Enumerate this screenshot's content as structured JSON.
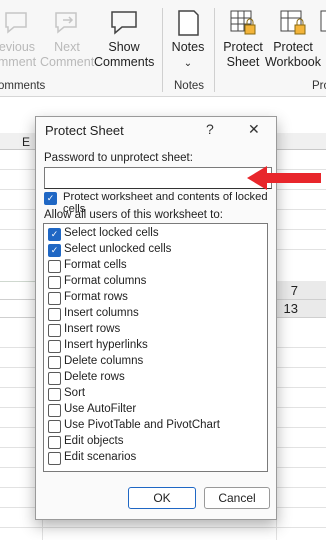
{
  "ribbon": {
    "previous_comment": "Previous Comment",
    "previous_comment_parts": [
      "evious",
      "mment"
    ],
    "next_comment": [
      "Next",
      "Comment"
    ],
    "show_comments": [
      "Show",
      "Comments"
    ],
    "notes": "Notes",
    "protect_sheet": [
      "Protect",
      "Sheet"
    ],
    "protect_workbook": [
      "Protect",
      "Workbook"
    ],
    "protect_more": "Pro",
    "groups": {
      "comments": "Comments",
      "comments_visible": "omments",
      "notes": "Notes",
      "protect": "Pro"
    }
  },
  "sheet": {
    "col_e": "E",
    "values": [
      "7",
      "13"
    ]
  },
  "dialog": {
    "title": "Protect Sheet",
    "help": "?",
    "close": "✕",
    "password_label": "Password to unprotect sheet:",
    "password_value": "",
    "protect_label": "Protect worksheet and contents of locked cells",
    "protect_checked": true,
    "allow_label": "Allow all users of this worksheet to:",
    "options": [
      {
        "label": "Select locked cells",
        "checked": true
      },
      {
        "label": "Select unlocked cells",
        "checked": true
      },
      {
        "label": "Format cells",
        "checked": false
      },
      {
        "label": "Format columns",
        "checked": false
      },
      {
        "label": "Format rows",
        "checked": false
      },
      {
        "label": "Insert columns",
        "checked": false
      },
      {
        "label": "Insert rows",
        "checked": false
      },
      {
        "label": "Insert hyperlinks",
        "checked": false
      },
      {
        "label": "Delete columns",
        "checked": false
      },
      {
        "label": "Delete rows",
        "checked": false
      },
      {
        "label": "Sort",
        "checked": false
      },
      {
        "label": "Use AutoFilter",
        "checked": false
      },
      {
        "label": "Use PivotTable and PivotChart",
        "checked": false
      },
      {
        "label": "Edit objects",
        "checked": false
      },
      {
        "label": "Edit scenarios",
        "checked": false
      }
    ],
    "ok": "OK",
    "cancel": "Cancel"
  },
  "colors": {
    "accent": "#1f67c4",
    "arrow": "#e8262b"
  }
}
